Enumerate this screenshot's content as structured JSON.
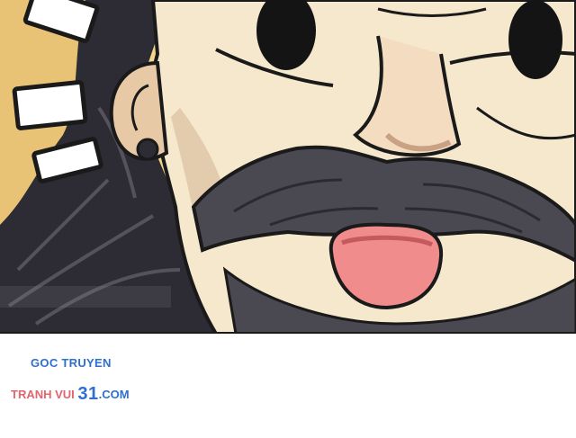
{
  "colors": {
    "brand_blue": "#2f6fd0",
    "brand_pink": "#e2646e",
    "skin": "#f6e8cd",
    "skin_shadow": "#d9b493",
    "hair": "#2d2b33",
    "mustache": "#4a4850",
    "mouth": "#f08c8c",
    "sky": "#f6d88a"
  },
  "watermark": {
    "line1": "GOC TRUYEN",
    "line2_prefix": "TRANH VUI ",
    "line2_number": "31",
    "line2_suffix": ".COM"
  }
}
